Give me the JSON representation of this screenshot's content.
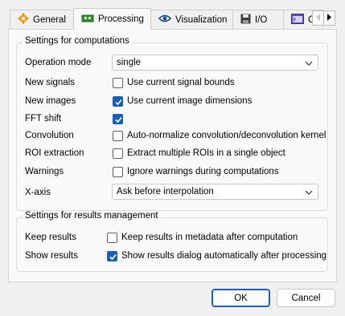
{
  "tabs": [
    {
      "label": "General",
      "icon": "gear-icon"
    },
    {
      "label": "Processing",
      "icon": "circuit-board-icon"
    },
    {
      "label": "Visualization",
      "icon": "eye-icon"
    },
    {
      "label": "I/O",
      "icon": "floppy-disk-icon"
    },
    {
      "label": "C",
      "icon": "console-icon"
    }
  ],
  "active_tab": "Processing",
  "computations": {
    "title": "Settings for computations",
    "operation_mode": {
      "label": "Operation mode",
      "value": "single"
    },
    "new_signals": {
      "label": "New signals",
      "text": "Use current signal bounds",
      "checked": false
    },
    "new_images": {
      "label": "New images",
      "text": "Use current image dimensions",
      "checked": true
    },
    "fft_shift": {
      "label": "FFT shift",
      "checked": true
    },
    "convolution": {
      "label": "Convolution",
      "text": "Auto-normalize convolution/deconvolution kernel",
      "checked": false
    },
    "roi_extraction": {
      "label": "ROI extraction",
      "text": "Extract multiple ROIs in a single object",
      "checked": false
    },
    "warnings": {
      "label": "Warnings",
      "text": "Ignore warnings during computations",
      "checked": false
    },
    "x_axis": {
      "label": "X-axis",
      "value": "Ask before interpolation"
    }
  },
  "results": {
    "title": "Settings for results management",
    "keep_results": {
      "label": "Keep results",
      "text": "Keep results in metadata after computation",
      "checked": false
    },
    "show_results": {
      "label": "Show results",
      "text": "Show results dialog automatically after processing",
      "checked": true
    }
  },
  "buttons": {
    "ok": "OK",
    "cancel": "Cancel"
  },
  "colors": {
    "accent": "#1a5fb4",
    "background": "#f0f0f0",
    "panel": "#f9f9f9"
  }
}
